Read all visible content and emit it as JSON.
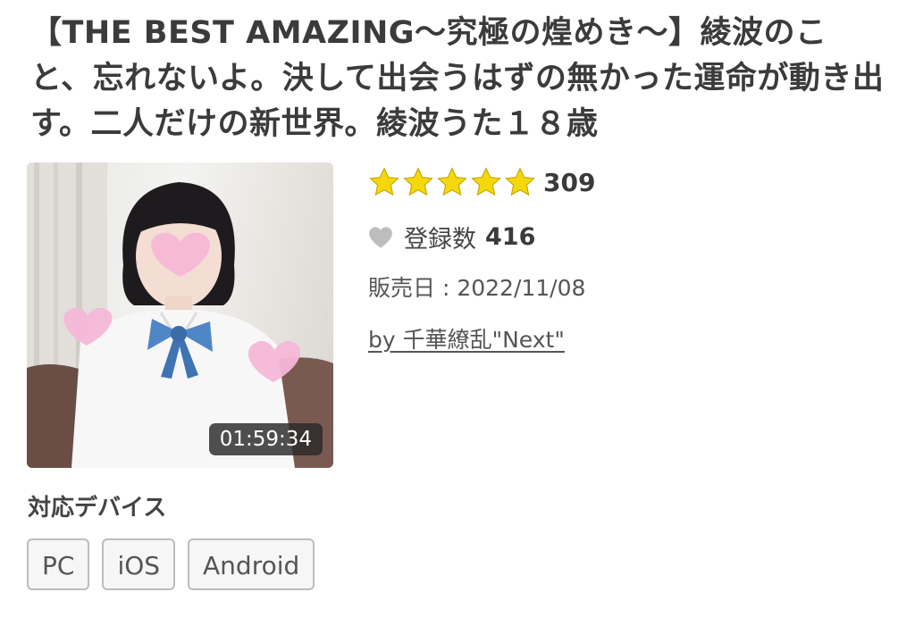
{
  "title": "【THE BEST AMAZING〜究極の煌めき〜】綾波のこと、忘れないよ。決して出会うはずの無かった運命が動き出す。二人だけの新世界。綾波うた１８歳",
  "thumbnail": {
    "duration": "01:59:34"
  },
  "rating": {
    "stars": 5,
    "max": 5,
    "count": "309",
    "star_color": "#f5d80b"
  },
  "favorites": {
    "icon": "heart-icon",
    "label": "登録数",
    "count": "416"
  },
  "release": {
    "text": "販売日 : 2022/11/08"
  },
  "seller": {
    "text": "by 千華繚乱\"Next\""
  },
  "devices": {
    "label": "対応デバイス",
    "items": [
      "PC",
      "iOS",
      "Android"
    ]
  }
}
